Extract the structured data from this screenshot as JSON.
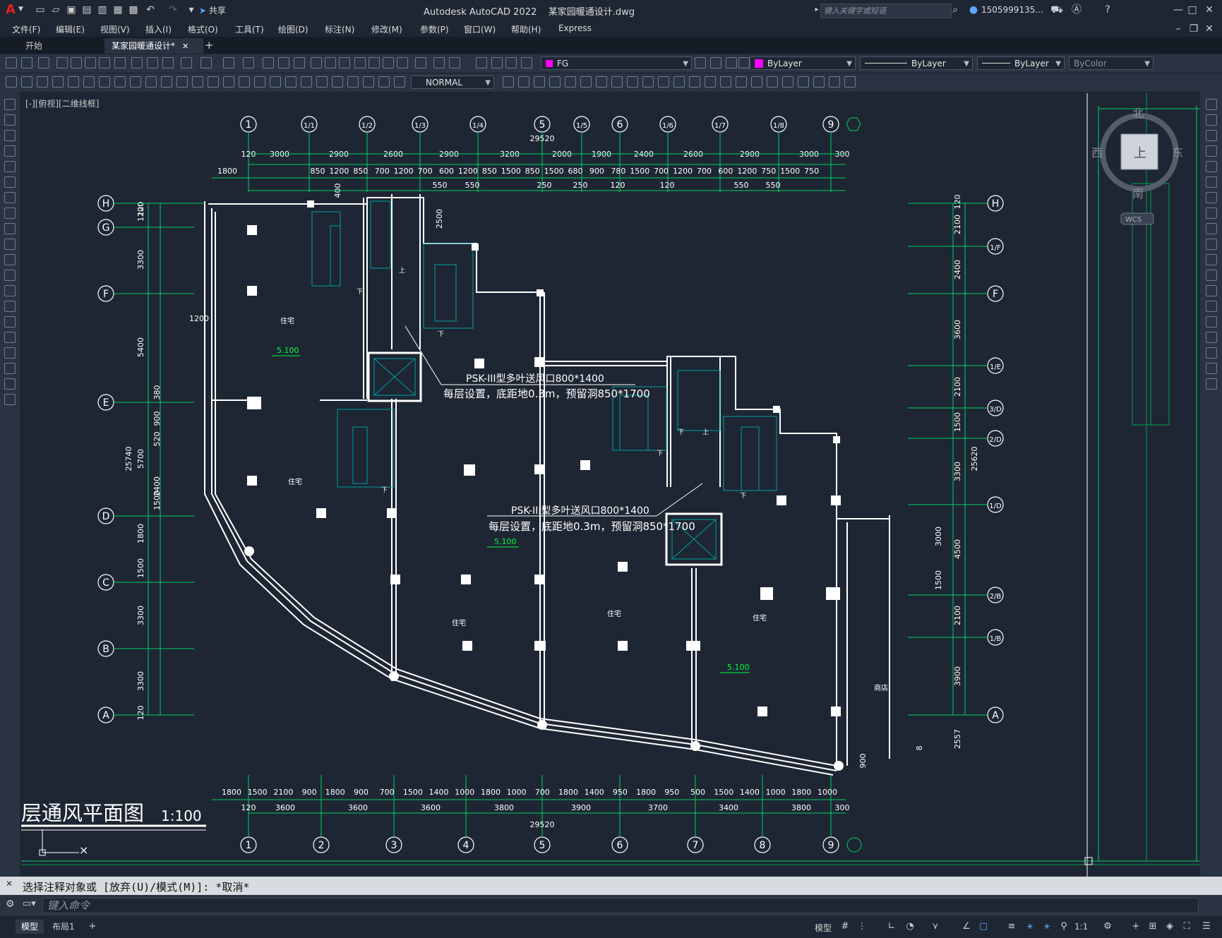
{
  "titlebar": {
    "app_title": "Autodesk AutoCAD 2022    某家园暖通设计.dwg",
    "share_label": "共享",
    "search_placeholder": "键入关键字或短语",
    "user": "1505999135...",
    "logo": "A"
  },
  "menu": [
    "文件(F)",
    "编辑(E)",
    "视图(V)",
    "插入(I)",
    "格式(O)",
    "工具(T)",
    "绘图(D)",
    "标注(N)",
    "修改(M)",
    "参数(P)",
    "窗口(W)",
    "帮助(H)",
    "Express"
  ],
  "tabs": [
    {
      "label": "开始",
      "active": false
    },
    {
      "label": "某家园暖通设计*",
      "active": true
    }
  ],
  "properties": {
    "layer": "FG",
    "color": "ByLayer",
    "linetype": "ByLayer",
    "lineweight": "ByLayer",
    "plotstyle": "ByColor",
    "layer_color": "#ff00ff",
    "dimstyle": "NORMAL"
  },
  "viewport_label": "[-][俯视][二维线框]",
  "viewcube": {
    "north": "北",
    "south": "南",
    "east": "东",
    "west": "西",
    "top": "上",
    "wcs": "WCS"
  },
  "drawing": {
    "title": "层通风平面图",
    "scale": "1:100",
    "top_axes": [
      "1",
      "1/1",
      "1/2",
      "1/3",
      "1/4",
      "5",
      "1/5",
      "6",
      "1/6",
      "1/7",
      "1/8",
      "9"
    ],
    "bottom_axes": [
      "1",
      "2",
      "3",
      "4",
      "5",
      "6",
      "7",
      "8",
      "9"
    ],
    "left_axes": [
      "H",
      "G",
      "F",
      "E",
      "D",
      "C",
      "B",
      "A"
    ],
    "right_axes": [
      "H",
      "1/F",
      "F",
      "1/E",
      "3/D",
      "2/D",
      "1/D",
      "2/B",
      "1/B",
      "A"
    ],
    "top_total": "29520",
    "bottom_total": "29520",
    "left_total": "25740",
    "right_total": "25620",
    "top_dims_row1": [
      "120",
      "3000",
      "2900",
      "2600",
      "2900",
      "3200",
      "2000",
      "1900",
      "2400",
      "2600",
      "2900",
      "3000",
      "300"
    ],
    "top_dims_row2": [
      "1800",
      "850",
      "1200",
      "850",
      "700",
      "1200",
      "700",
      "600",
      "1200",
      "850",
      "1500",
      "850",
      "1500",
      "680",
      "900",
      "780",
      "1500",
      "700",
      "1200",
      "700",
      "600",
      "1200",
      "750",
      "1500",
      "750"
    ],
    "top_dims_row3": [
      "550",
      "550",
      "250",
      "250",
      "120",
      "120",
      "550",
      "550"
    ],
    "bottom_dims_row1": [
      "1800",
      "1500",
      "2100",
      "900",
      "1800",
      "900",
      "700",
      "1500",
      "1400",
      "1000",
      "1800",
      "1000",
      "700",
      "1800",
      "1400",
      "950",
      "1800",
      "950",
      "500",
      "1500",
      "1400",
      "1000",
      "1800",
      "1000"
    ],
    "bottom_dims_row2": [
      "120",
      "3600",
      "3600",
      "3600",
      "3800",
      "3900",
      "3700",
      "3400",
      "3800",
      "300"
    ],
    "left_dims": [
      "1200",
      "120",
      "3300",
      "5400",
      "380",
      "900",
      "520",
      "5700",
      "2400",
      "1500",
      "1800",
      "1500",
      "3300",
      "3300",
      "120"
    ],
    "right_dims": [
      "120",
      "2100",
      "2400",
      "3600",
      "2100",
      "1500",
      "3300",
      "3000",
      "4500",
      "1500",
      "2100",
      "3900",
      "2557"
    ],
    "misc_dims": [
      "1200",
      "400",
      "2500",
      "900",
      "8"
    ],
    "room_labels": [
      "住宅",
      "住宅",
      "住宅",
      "住宅",
      "住宅",
      "商店"
    ],
    "levels": [
      "5.100",
      "5.100",
      "5.100"
    ],
    "stair_labels": [
      "下",
      "上",
      "下",
      "下",
      "下",
      "上",
      "下",
      "下"
    ],
    "annotation1_line1": "PSK-III型多叶送风口800*1400",
    "annotation1_line2": "每层设置，底距地0.3m，预留洞850*1700",
    "annotation2_line1": "PSK-III型多叶送风口800*1400",
    "annotation2_line2": "每层设置，底距地0.3m，预留洞850*1700"
  },
  "command": {
    "history": "选择注释对象或 [放弃(U)/模式(M)]: *取消*",
    "placeholder": "键入命令"
  },
  "status": {
    "layout_tabs": [
      {
        "label": "模型",
        "active": true
      },
      {
        "label": "布局1",
        "active": false
      }
    ],
    "model_label": "模型",
    "scale": "1:1"
  }
}
